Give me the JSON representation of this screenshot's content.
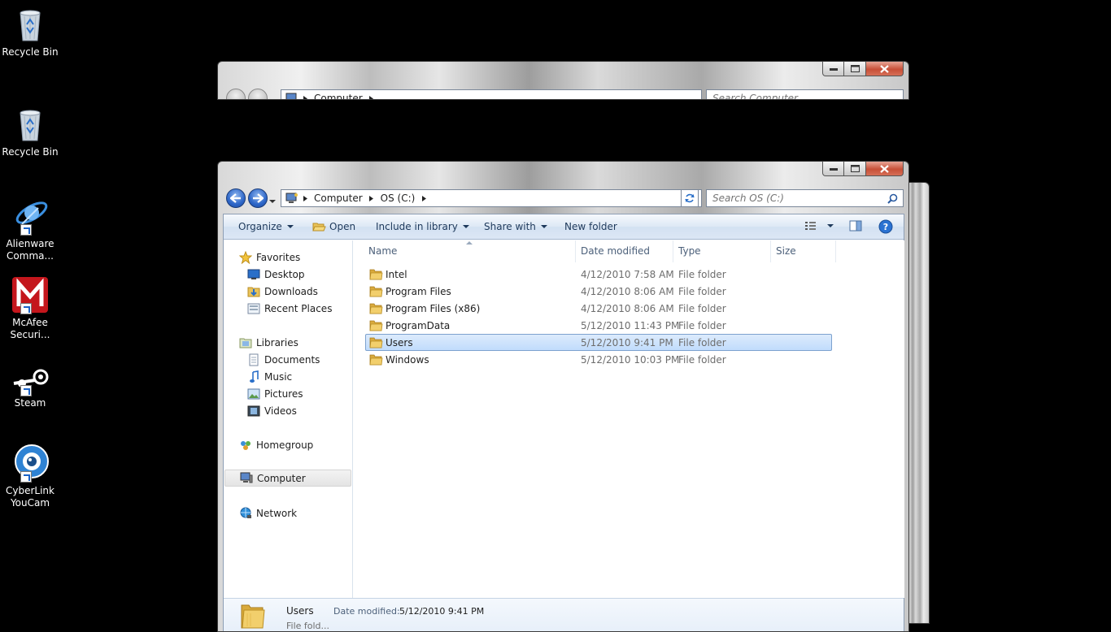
{
  "desktop": {
    "icons": [
      {
        "label": "Recycle Bin",
        "icon": "recycle-bin-icon"
      },
      {
        "label": "Recycle Bin",
        "icon": "recycle-bin-icon"
      },
      {
        "label": "Alienware Comma...",
        "icon": "alienware-icon"
      },
      {
        "label": "McAfee Securi...",
        "icon": "mcafee-icon"
      },
      {
        "label": "Steam",
        "icon": "steam-icon"
      },
      {
        "label": "CyberLink YouCam",
        "icon": "youcam-icon"
      }
    ]
  },
  "back_window": {
    "crumbs": [
      "Computer"
    ],
    "search_placeholder": "Search Computer"
  },
  "window": {
    "crumbs": [
      "Computer",
      "OS (C:)"
    ],
    "search_placeholder": "Search OS (C:)"
  },
  "toolbar": {
    "organize": "Organize",
    "open": "Open",
    "include": "Include in library",
    "share": "Share with",
    "new_folder": "New folder"
  },
  "nav": {
    "favorites": "Favorites",
    "desktop": "Desktop",
    "downloads": "Downloads",
    "recent": "Recent Places",
    "libraries": "Libraries",
    "documents": "Documents",
    "music": "Music",
    "pictures": "Pictures",
    "videos": "Videos",
    "homegroup": "Homegroup",
    "computer": "Computer",
    "network": "Network"
  },
  "columns": {
    "name": "Name",
    "date": "Date modified",
    "type": "Type",
    "size": "Size"
  },
  "files": [
    {
      "name": "Intel",
      "date": "4/12/2010 7:58 AM",
      "type": "File folder"
    },
    {
      "name": "Program Files",
      "date": "4/12/2010 8:06 AM",
      "type": "File folder"
    },
    {
      "name": "Program Files (x86)",
      "date": "4/12/2010 8:06 AM",
      "type": "File folder"
    },
    {
      "name": "ProgramData",
      "date": "5/12/2010 11:43 PM",
      "type": "File folder"
    },
    {
      "name": "Users",
      "date": "5/12/2010 9:41 PM",
      "type": "File folder"
    },
    {
      "name": "Windows",
      "date": "5/12/2010 10:03 PM",
      "type": "File folder"
    }
  ],
  "selected_index": 4,
  "details": {
    "name": "Users",
    "date_label": "Date modified:",
    "date_value": "5/12/2010 9:41 PM",
    "type": "File fold..."
  }
}
